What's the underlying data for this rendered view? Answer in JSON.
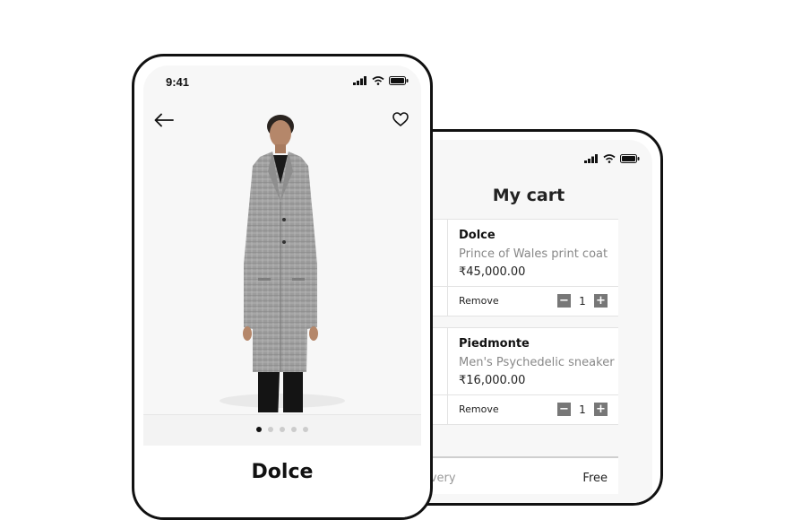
{
  "product_screen": {
    "status_time": "9:41",
    "title": "Dolce",
    "carousel": {
      "count": 5,
      "active_index": 0
    }
  },
  "cart_screen": {
    "title": "My cart",
    "items": [
      {
        "brand": "Dolce",
        "description": "Prince of Wales print coat",
        "price": "₹45,000.00",
        "remove_label": "Remove",
        "quantity": "1"
      },
      {
        "brand": "Piedmonte",
        "description": "Men's Psychedelic sneaker",
        "price": "₹16,000.00",
        "remove_label": "Remove",
        "quantity": "1"
      }
    ],
    "delivery_label": "d delivery",
    "delivery_value": "Free",
    "qty_minus": "−",
    "qty_plus": "+"
  },
  "icons": [
    "signal-icon",
    "wifi-icon",
    "battery-icon",
    "back-arrow-icon",
    "heart-icon"
  ],
  "colors": {
    "frame": "#111111",
    "screen_bg": "#f7f7f7",
    "muted_text": "#888888",
    "qty_button": "#777777"
  }
}
